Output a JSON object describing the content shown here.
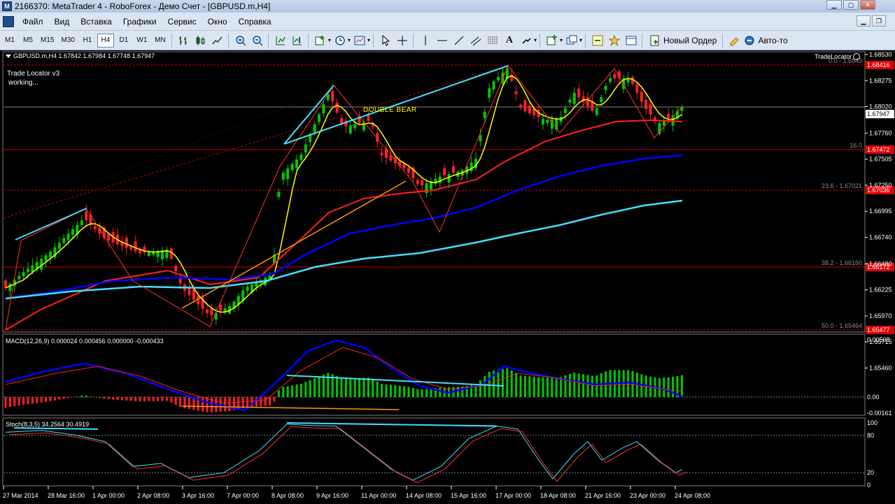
{
  "window": {
    "title": "2166370: MetaTrader 4 - RoboForex - Демо Счет - [GBPUSD.m,H4]"
  },
  "menu": [
    "Файл",
    "Вид",
    "Вставка",
    "Графики",
    "Сервис",
    "Окно",
    "Справка"
  ],
  "timeframes": [
    "M1",
    "M5",
    "M15",
    "M30",
    "H1",
    "H4",
    "D1",
    "W1",
    "MN"
  ],
  "active_timeframe": "H4",
  "toolbar": {
    "new_order_label": "Новый Ордер",
    "autotrade_label": "Авто-то"
  },
  "chart": {
    "header": "GBPUSD.m,H4  1.67842 1.67984 1.67748 1.67947",
    "indicator_name": "Trade Locator v3",
    "indicator_status": "working...",
    "panel_label": "TradeLocator",
    "pattern_label": "DOUBLE BEAR",
    "price_axis": [
      "1.68530",
      "1.68275",
      "1.68020",
      "1.67760",
      "1.67505",
      "1.67250",
      "1.66995",
      "1.66740",
      "1.66480",
      "1.66225",
      "1.65970",
      "1.65715",
      "1.65460"
    ],
    "current_price": "1.67947",
    "fib_levels": [
      {
        "label": "0.0 - 1.6843",
        "tag": "1.68416"
      },
      {
        "label": "16.0",
        "tag": "1.67472"
      },
      {
        "label": "23.6 - 1.67021",
        "tag": "1.67036"
      },
      {
        "label": "38.2 - 1.66160",
        "tag": "1.66172"
      },
      {
        "label": "50.0 - 1.65464",
        "tag": "1.65477"
      }
    ],
    "time_axis": [
      "27 Mar 2014",
      "28 Mar 16:00",
      "1 Apr 00:00",
      "2 Apr 08:00",
      "3 Apr 16:00",
      "7 Apr 00:00",
      "8 Apr 08:00",
      "9 Apr 16:00",
      "11 Apr 00:00",
      "14 Apr 08:00",
      "15 Apr 16:00",
      "17 Apr 00:00",
      "18 Apr 08:00",
      "21 Apr 16:00",
      "23 Apr 00:00",
      "24 Apr 08:00"
    ]
  },
  "macd": {
    "header": "MACD(12,26,9) 0.000024 0.000456 0.000000 -0.000433",
    "axis": [
      "0.00508",
      "0.00",
      "-0.00161"
    ]
  },
  "stoch": {
    "header": "Stoch(8,3,5) 34.2564 30.4919",
    "axis": [
      "100",
      "80",
      "20",
      "0"
    ]
  },
  "colors": {
    "bull": "#00c800",
    "bear": "#ff2020",
    "ma_fast": "#ffff00",
    "ma_mid": "#ff2020",
    "ma_slow": "#0000ff",
    "ma_long": "#40e0ff",
    "macd_main": "#0000ff",
    "macd_signal": "#ff2020",
    "trend_line": "#40e0ff",
    "fib_line": "#d00000"
  }
}
